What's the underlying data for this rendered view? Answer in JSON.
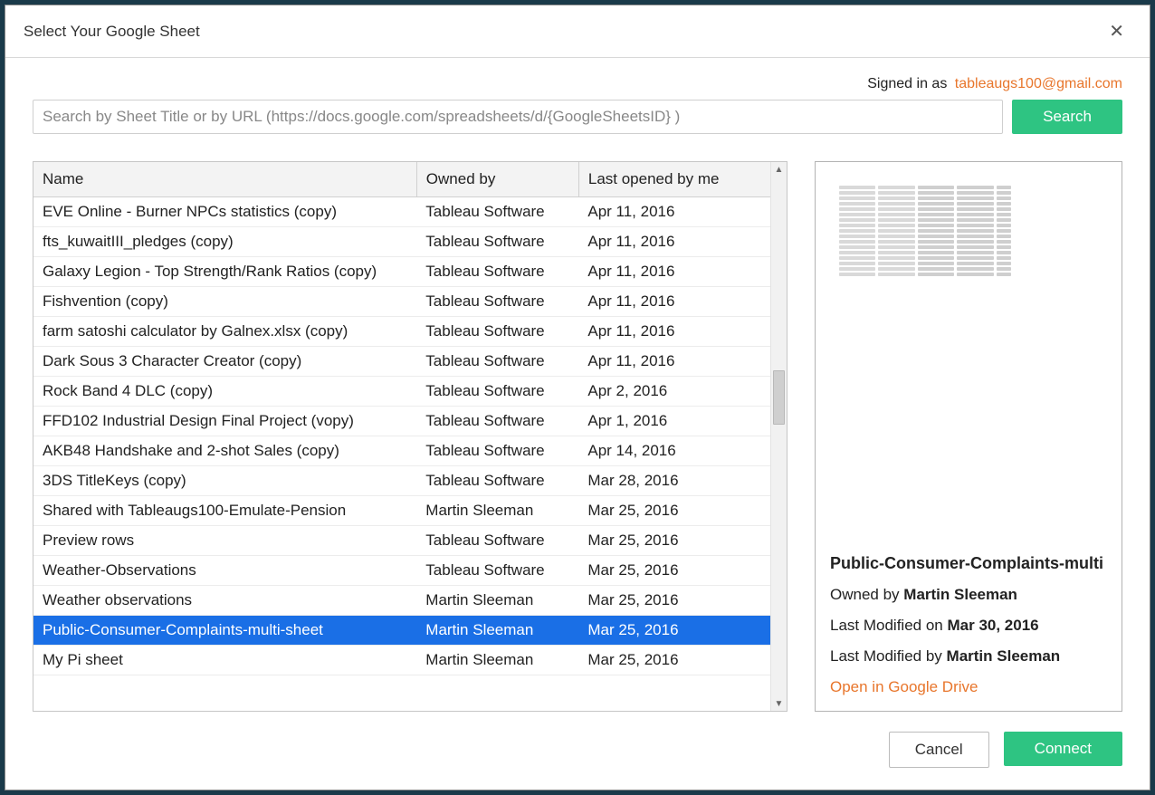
{
  "dialog": {
    "title": "Select Your Google Sheet"
  },
  "auth": {
    "signed_in_label": "Signed in as",
    "email": "tableaugs100@gmail.com"
  },
  "search": {
    "placeholder": "Search by Sheet Title or by URL (https://docs.google.com/spreadsheets/d/{GoogleSheetsID} )",
    "button_label": "Search"
  },
  "table": {
    "columns": {
      "name": "Name",
      "owner": "Owned by",
      "opened": "Last opened by me"
    },
    "rows": [
      {
        "name": "EVE Online - Burner NPCs statistics (copy)",
        "owner": "Tableau Software",
        "opened": "Apr 11, 2016",
        "selected": false
      },
      {
        "name": "fts_kuwaitIII_pledges (copy)",
        "owner": "Tableau Software",
        "opened": "Apr 11, 2016",
        "selected": false
      },
      {
        "name": "Galaxy Legion - Top Strength/Rank Ratios (copy)",
        "owner": "Tableau Software",
        "opened": "Apr 11, 2016",
        "selected": false
      },
      {
        "name": "Fishvention (copy)",
        "owner": "Tableau Software",
        "opened": "Apr 11, 2016",
        "selected": false
      },
      {
        "name": "farm satoshi calculator by Galnex.xlsx (copy)",
        "owner": "Tableau Software",
        "opened": "Apr 11, 2016",
        "selected": false
      },
      {
        "name": "Dark Sous 3 Character Creator (copy)",
        "owner": "Tableau Software",
        "opened": "Apr 11, 2016",
        "selected": false
      },
      {
        "name": "Rock Band 4 DLC (copy)",
        "owner": "Tableau Software",
        "opened": "Apr 2, 2016",
        "selected": false
      },
      {
        "name": "FFD102 Industrial Design Final Project (vopy)",
        "owner": "Tableau Software",
        "opened": "Apr 1, 2016",
        "selected": false
      },
      {
        "name": "AKB48 Handshake and 2-shot Sales (copy)",
        "owner": "Tableau Software",
        "opened": "Apr 14, 2016",
        "selected": false
      },
      {
        "name": "3DS TitleKeys (copy)",
        "owner": "Tableau Software",
        "opened": "Mar 28, 2016",
        "selected": false
      },
      {
        "name": "Shared with Tableaugs100-Emulate-Pension",
        "owner": "Martin Sleeman",
        "opened": "Mar 25, 2016",
        "selected": false
      },
      {
        "name": "Preview rows",
        "owner": "Tableau Software",
        "opened": "Mar 25, 2016",
        "selected": false
      },
      {
        "name": "Weather-Observations",
        "owner": "Tableau Software",
        "opened": "Mar 25, 2016",
        "selected": false
      },
      {
        "name": "Weather observations",
        "owner": "Martin Sleeman",
        "opened": "Mar 25, 2016",
        "selected": false
      },
      {
        "name": "Public-Consumer-Complaints-multi-sheet",
        "owner": "Martin Sleeman",
        "opened": "Mar 25, 2016",
        "selected": true
      },
      {
        "name": "My Pi sheet",
        "owner": "Martin Sleeman",
        "opened": "Mar 25, 2016",
        "selected": false
      }
    ]
  },
  "details": {
    "title": "Public-Consumer-Complaints-multi",
    "owned_label": "Owned by",
    "owner": "Martin Sleeman",
    "modified_on_label": "Last Modified on",
    "modified_on": "Mar 30, 2016",
    "modified_by_label": "Last Modified by",
    "modified_by": "Martin Sleeman",
    "open_link": "Open in Google Drive"
  },
  "footer": {
    "cancel": "Cancel",
    "connect": "Connect"
  }
}
